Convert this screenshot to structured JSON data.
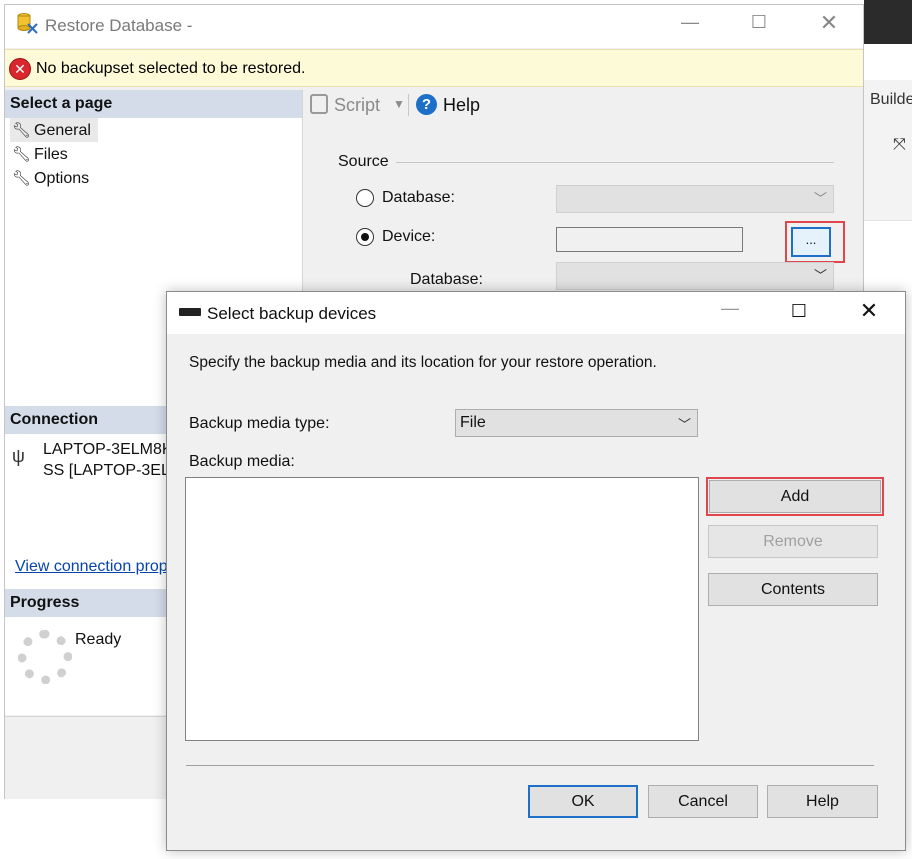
{
  "background_app": {
    "toolbar_partial_label": "Builde"
  },
  "restore_window": {
    "title": "Restore Database -",
    "error_message": "No backupset selected to be restored.",
    "select_page_header": "Select a page",
    "pages": [
      {
        "label": "General"
      },
      {
        "label": "Files"
      },
      {
        "label": "Options"
      }
    ],
    "toolbar": {
      "script_label": "Script",
      "help_label": "Help"
    },
    "source": {
      "section_label": "Source",
      "database_radio_label": "Database:",
      "device_radio_label": "Device:",
      "browse_label": "...",
      "sub_database_label": "Database:"
    },
    "connection": {
      "header": "Connection",
      "line1": "LAPTOP-3ELM8K",
      "line2": "SS [LAPTOP-3EL",
      "link": "View connection prop"
    },
    "progress": {
      "header": "Progress",
      "status": "Ready"
    }
  },
  "backup_dialog": {
    "title": "Select backup devices",
    "description": "Specify the backup media and its location for your restore operation.",
    "media_type_label": "Backup media type:",
    "media_type_value": "File",
    "media_list_label": "Backup media:",
    "buttons": {
      "add": "Add",
      "remove": "Remove",
      "contents": "Contents",
      "ok": "OK",
      "cancel": "Cancel",
      "help": "Help"
    }
  },
  "colors": {
    "accent": "#1e6fc8",
    "error": "#d9272e",
    "highlight_box": "#e0474c",
    "message_bar": "#fdfbd7"
  }
}
